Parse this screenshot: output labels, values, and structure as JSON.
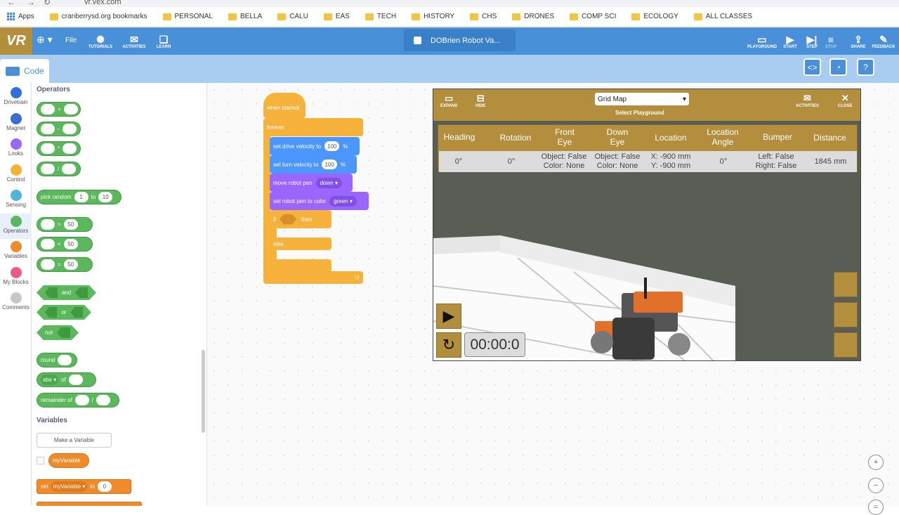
{
  "browser": {
    "url": "vr.vex.com",
    "bookmarks": [
      "Apps",
      "cranberrysd.org bookmarks",
      "PERSONAL",
      "BELLA",
      "CALU",
      "EAS",
      "TECH",
      "HISTORY",
      "CHS",
      "DRONES",
      "COMP SCI",
      "ECOLOGY",
      "ALL CLASSES"
    ]
  },
  "topbar": {
    "logo": "VR",
    "file": "File",
    "tutorials": "TUTORIALS",
    "activities": "ACTIVITIES",
    "learn": "LEARN",
    "project_name": "DOBrien Robot Va...",
    "playground": "PLAYGROUND",
    "start": "START",
    "step": "STEP",
    "stop": "STOP",
    "share": "SHARE",
    "feedback": "FEEDBACK"
  },
  "subbar": {
    "code_tab": "Code"
  },
  "categories": [
    {
      "label": "Drivetrain",
      "color": "#2f6fe0"
    },
    {
      "label": "Magnet",
      "color": "#3a6fd0"
    },
    {
      "label": "Looks",
      "color": "#9966ff"
    },
    {
      "label": "Control",
      "color": "#f7b23b"
    },
    {
      "label": "Sensing",
      "color": "#4fb6d9"
    },
    {
      "label": "Operators",
      "color": "#5cb85c"
    },
    {
      "label": "Variables",
      "color": "#f08b2b"
    },
    {
      "label": "My Blocks",
      "color": "#f05a7e"
    },
    {
      "label": "Comments",
      "color": "#c8c8c8"
    }
  ],
  "palette": {
    "operators_heading": "Operators",
    "ops": [
      "+",
      "-",
      "*",
      "/"
    ],
    "pick_random": "pick random",
    "pick_from": "1",
    "pick_to_label": "to",
    "pick_to": "10",
    "compare": [
      {
        "op": ">",
        "val": "50"
      },
      {
        "op": "<",
        "val": "50"
      },
      {
        "op": "=",
        "val": "50"
      }
    ],
    "and": "and",
    "or": "or",
    "not": "not",
    "round": "round",
    "abs": "abs",
    "of": "of",
    "remainder_of": "remainder of",
    "remainder_sep": "/",
    "variables_heading": "Variables",
    "make_variable": "Make a Variable",
    "my_variable": "myVariable",
    "set": "set",
    "set_to": "to",
    "set_value": "0"
  },
  "script": {
    "when_started": "when started",
    "forever": "forever",
    "drive_velocity": "set drive velocity to",
    "drive_velocity_val": "100",
    "turn_velocity": "set turn velocity to",
    "turn_velocity_val": "100",
    "percent": "%",
    "move_pen": "move robot pen",
    "move_pen_val": "down",
    "pen_color": "set robot pen to color",
    "pen_color_val": "green",
    "if": "if",
    "then": "then",
    "else": "else"
  },
  "playground": {
    "expand": "EXPAND",
    "hide": "HIDE",
    "selected_map": "Grid Map",
    "select_label": "Select Playground",
    "activities": "ACTIVITIES",
    "close": "CLOSE",
    "headers": [
      "Heading",
      "Rotation",
      "Front\nEye",
      "Down\nEye",
      "Location",
      "Location\nAngle",
      "Bumper",
      "Distance"
    ],
    "values": [
      "0°",
      "0°",
      "Object: False\nColor: None",
      "Object: False\nColor: None",
      "X: -900 mm\nY: -900 mm",
      "0°",
      "Left: False\nRight: False",
      "1845 mm"
    ],
    "timer": "00:00:0"
  }
}
